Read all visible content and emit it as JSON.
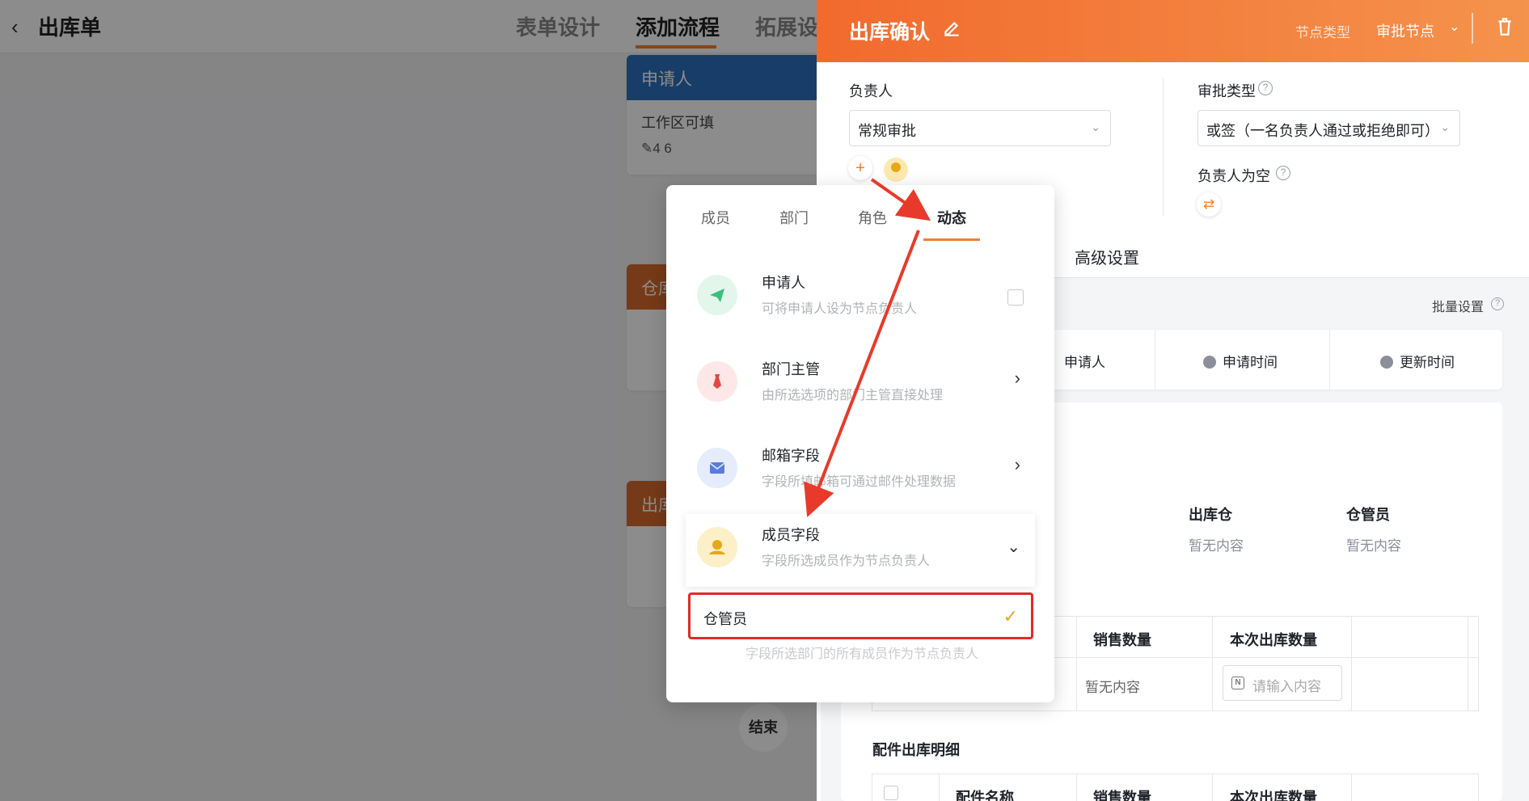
{
  "app": {
    "page_title": "出库单",
    "tabs": [
      "表单设计",
      "添加流程",
      "拓展设"
    ]
  },
  "flow_nodes": [
    {
      "title": "申请人",
      "line1": "工作区可填",
      "stats": "4  6",
      "color": "#2f6fc0"
    },
    {
      "title": "仓库",
      "color": "#d86a2c"
    },
    {
      "title": "出库",
      "color": "#d86a2c"
    }
  ],
  "end_node": "结束",
  "drawer": {
    "title": "出库确认",
    "node_type_label": "节点类型",
    "node_type_value": "审批节点",
    "owner_label": "负责人",
    "owner_select": "常规审批",
    "approve_type_label": "审批类型",
    "approve_type_value": "或签（一名负责人通过或拒绝即可）",
    "empty_owner_label": "负责人为空",
    "advanced_tab": "高级设置",
    "batch_label": "批量设置",
    "field_chips": [
      "申请人",
      "申请时间",
      "更新时间"
    ],
    "kv": [
      {
        "label": "出库仓",
        "value": "暂无内容"
      },
      {
        "label": "仓管员",
        "value": "暂无内容"
      }
    ],
    "table1": {
      "headers": [
        "销售数量",
        "本次出库数量"
      ],
      "cell": "暂无内容",
      "input_placeholder": "请输入内容"
    },
    "section_title": "配件出库明细",
    "table2": {
      "headers": [
        "配件名称",
        "销售数量",
        "本次出库数量"
      ]
    }
  },
  "popup": {
    "tabs": [
      "成员",
      "部门",
      "角色",
      "动态"
    ],
    "active_tab": "动态",
    "items": [
      {
        "title": "申请人",
        "desc": "可将申请人设为节点负责人",
        "icon": "paper-plane-icon",
        "color": "#3cbf7a",
        "bg": "#e3f6ec"
      },
      {
        "title": "部门主管",
        "desc": "由所选选项的部门主管直接处理",
        "icon": "tie-icon",
        "color": "#e04848",
        "bg": "#fde7e7"
      },
      {
        "title": "邮箱字段",
        "desc": "字段所填邮箱可通过邮件处理数据",
        "icon": "mail-icon",
        "color": "#5b7be0",
        "bg": "#e6ecfb"
      },
      {
        "title": "成员字段",
        "desc": "字段所选成员作为节点负责人",
        "icon": "user-icon",
        "color": "#e6a817",
        "bg": "#fdf0c8"
      }
    ],
    "sub_option": "仓管员",
    "hidden_desc": "字段所选部门的所有成员作为节点负责人"
  }
}
